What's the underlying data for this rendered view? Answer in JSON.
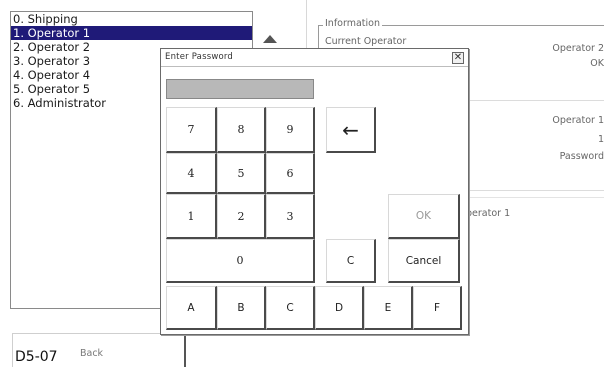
{
  "screen_code": "D5-07",
  "operator_list": {
    "items": [
      {
        "label": "0. Shipping",
        "selected": false
      },
      {
        "label": "1. Operator 1",
        "selected": true
      },
      {
        "label": "2. Operator 2",
        "selected": false
      },
      {
        "label": "3. Operator 3",
        "selected": false
      },
      {
        "label": "4. Operator 4",
        "selected": false
      },
      {
        "label": "5. Operator 5",
        "selected": false
      },
      {
        "label": "6. Administrator",
        "selected": false
      }
    ]
  },
  "info_panel": {
    "legend": "Information",
    "current_operator_label": "Current Operator",
    "current_operator_value": "Operator 2",
    "status_value": "OK"
  },
  "detail_panel": {
    "operator_value": "Operator 1",
    "number_value": "1",
    "password_label": "Password"
  },
  "status_line": "perator 1",
  "back_button": {
    "label": "Back"
  },
  "dialog": {
    "title": "Enter Password",
    "close_glyph": "✕",
    "password_value": "",
    "keys": {
      "k7": "7",
      "k8": "8",
      "k9": "9",
      "backspace": "←",
      "k4": "4",
      "k5": "5",
      "k6": "6",
      "k1": "1",
      "k2": "2",
      "k3": "3",
      "ok": "OK",
      "k0": "0",
      "clear": "C",
      "cancel": "Cancel",
      "ka": "A",
      "kb": "B",
      "kc": "C",
      "kd": "D",
      "ke": "E",
      "kf": "F"
    },
    "ok_enabled": false
  }
}
